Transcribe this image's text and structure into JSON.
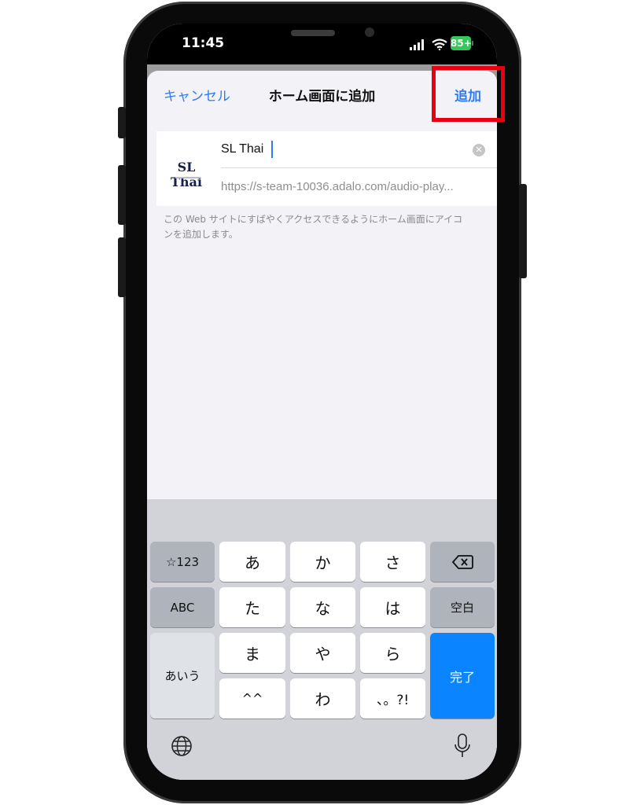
{
  "status_bar": {
    "time": "11:45",
    "battery": "85+"
  },
  "sheet": {
    "cancel_label": "キャンセル",
    "title": "ホーム画面に追加",
    "add_label": "追加"
  },
  "form": {
    "icon_text": "SL Thai",
    "name_value": "SL Thai",
    "url": "https://s-team-10036.adalo.com/audio-play..."
  },
  "help_text": "この Web サイトにすばやくアクセスできるようにホーム画面にアイコンを追加します。",
  "keyboard": {
    "rows": [
      [
        "☆123",
        "あ",
        "か",
        "さ"
      ],
      [
        "ABC",
        "た",
        "な",
        "は",
        "空白"
      ],
      [
        "あいう",
        "ま",
        "や",
        "ら",
        "完了"
      ],
      [
        "^^",
        "わ",
        "、。?!"
      ]
    ],
    "num_key": "☆123",
    "abc_key": "ABC",
    "kana_key": "あいう",
    "space_key": "空白",
    "done_key": "完了",
    "k_a": "あ",
    "k_ka": "か",
    "k_sa": "さ",
    "k_ta": "た",
    "k_na": "な",
    "k_ha": "は",
    "k_ma": "ま",
    "k_ya": "や",
    "k_ra": "ら",
    "k_caret": "^^",
    "k_wa": "わ",
    "k_punct": "、。?!"
  },
  "colors": {
    "accent": "#2f7cf6",
    "highlight": "#e60012",
    "done_key": "#0b84ff",
    "battery": "#34c759"
  }
}
